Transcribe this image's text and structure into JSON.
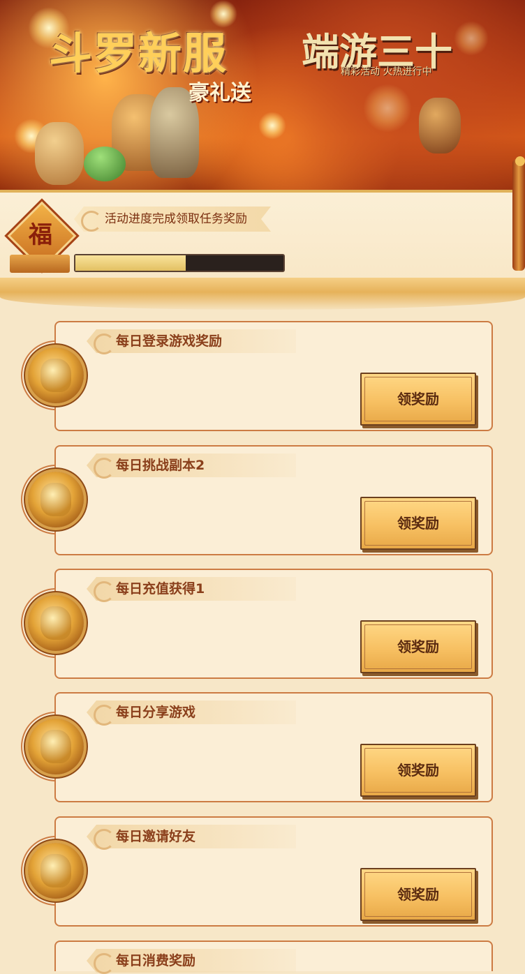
{
  "banner": {
    "title_left": "斗罗新服",
    "subtitle_left": "豪礼送",
    "title_right": "端游三十",
    "subtitle_right": "精彩活动 火热进行中"
  },
  "progress": {
    "label": "活动进度完成领取任务奖励",
    "badge_glyph": "福",
    "value": 0.53
  },
  "tasks": [
    {
      "title": "每日登录游戏奖励",
      "button": "领奖励"
    },
    {
      "title": "每日挑战副本2",
      "button": "领奖励"
    },
    {
      "title": "每日充值获得1",
      "button": "领奖励"
    },
    {
      "title": "每日分享游戏",
      "button": "领奖励"
    },
    {
      "title": "每日邀请好友",
      "button": "领奖励"
    },
    {
      "title": "每日消费奖励",
      "button": ""
    }
  ],
  "colors": {
    "accent": "#cc7b43",
    "button": "#f7c062",
    "progress_fill": "#e2c062",
    "progress_track": "#2a211d"
  },
  "icons": {
    "badge": "fortune-diamond-icon",
    "task": "gold-reward-coin-icon",
    "ribbon": "swirl-ornament-icon"
  }
}
